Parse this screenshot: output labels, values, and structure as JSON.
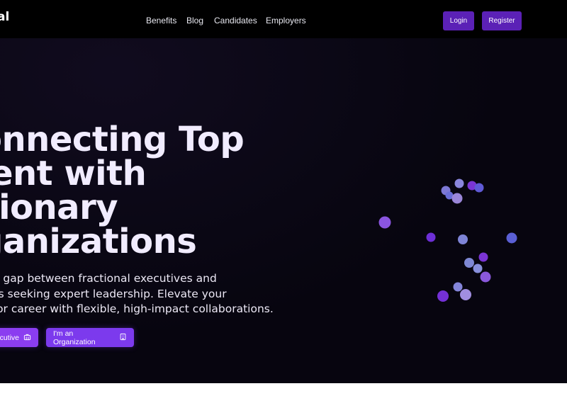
{
  "header": {
    "logo_text": "al",
    "nav": [
      {
        "label": "Benefits"
      },
      {
        "label": "Blog"
      },
      {
        "label": "Candidates"
      },
      {
        "label": "Employers"
      }
    ],
    "login_label": "Login",
    "register_label": "Register"
  },
  "hero": {
    "headline_lines": [
      "onnecting Top",
      "lent with",
      "sionary",
      "ganizations"
    ],
    "subtext_lines": [
      "the gap between fractional executives and",
      "nies seeking expert leadership. Elevate your",
      "ss or career with flexible, high-impact collaborations."
    ],
    "cta_executive": "cutive",
    "cta_organization": "I'm an Organization"
  },
  "colors": {
    "header_bg": "#000000",
    "hero_bg": "#07050f",
    "accent": "#7c3aed",
    "header_button": "#5b21b6"
  },
  "icons": {
    "cta_executive_icon": "briefcase-icon",
    "cta_organization_icon": "building-icon"
  }
}
